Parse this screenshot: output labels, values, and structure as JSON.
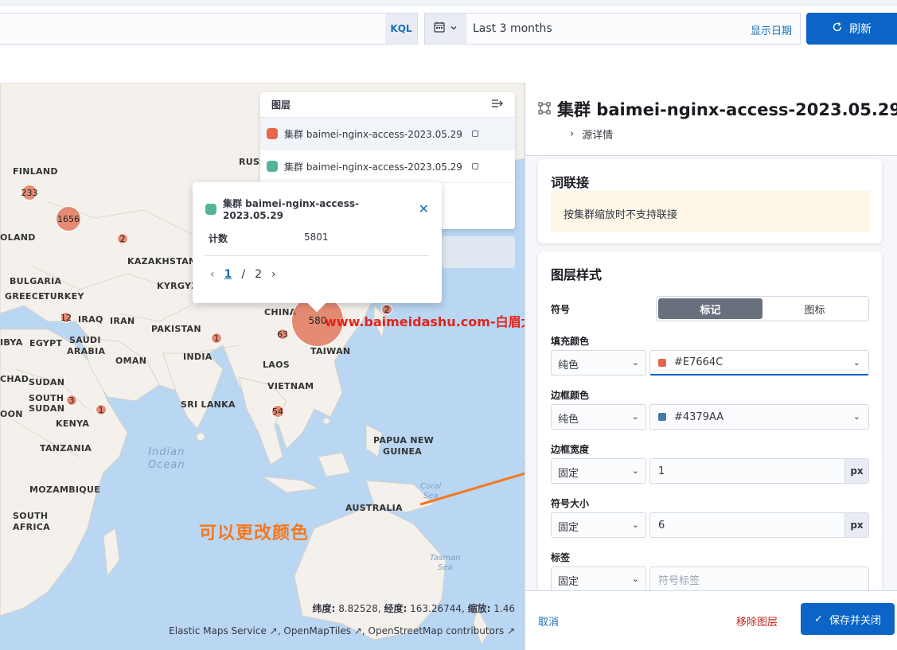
{
  "query_bar": {
    "kql_label": "KQL",
    "date_range": "Last 3 months",
    "show_dates": "显示日期",
    "refresh_label": "刷新"
  },
  "map": {
    "countries": [
      "FINLAND",
      "RUSS",
      "OLAND",
      "KAZAKHSTAN",
      "BULGARIA",
      "GREECE",
      "TURKEY",
      "KYRGYZS",
      "IRAQ",
      "IRAN",
      "CHINA",
      "PAKISTAN",
      "IBYA",
      "EGYPT",
      "SAUDI",
      "ARABIA",
      "INDIA",
      "TAIWAN",
      "OMAN",
      "LAOS",
      "CHAD",
      "SUDAN",
      "SOUTH",
      "SUDAN",
      "VIETNAM",
      "SRI LANKA",
      "OON",
      "KENYA",
      "PAPUA NEW",
      "GUINEA",
      "TANZANIA",
      "MOZAMBIQUE",
      "AUSTRALIA",
      "SOUTH",
      "AFRICA"
    ],
    "ocean_indian_1": "Indian",
    "ocean_indian_2": "Ocean",
    "coral_1": "Coral",
    "coral_2": "Sea",
    "tasman_1": "Tasman",
    "tasman_2": "Sea",
    "clusters": [
      "233",
      "1656",
      "2",
      "12",
      "63",
      "580",
      "2",
      "1",
      "3",
      "1",
      "54"
    ],
    "annotation": "可以更改颜色",
    "watermark": "www.baimeidashu.com-白眉大叔",
    "coords": {
      "lat_label": "纬度:",
      "lat": "8.82528,",
      "lon_label": "经度:",
      "lon": "163.26744,",
      "zoom_label": "缩放:",
      "zoom": "1.46"
    },
    "attribution": "Elastic Maps Service ↗, OpenMapTiles ↗, OpenStreetMap contributors ↗"
  },
  "layer_control": {
    "title": "图层",
    "layers": [
      {
        "name": "集群 baimei-nginx-access-2023.05.29",
        "color": "#E7664C"
      },
      {
        "name": "集群 baimei-nginx-access-2023.05.29",
        "color": "#54B399"
      }
    ]
  },
  "tooltip": {
    "title": "集群 baimei-nginx-access-2023.05.29",
    "color": "#54B399",
    "key": "计数",
    "value": "5801",
    "page_current": "1",
    "page_sep": "/",
    "page_total": "2"
  },
  "panel": {
    "title": "集群 baimei-nginx-access-2023.05.29",
    "source_details": "源详情",
    "join_card": {
      "title": "词联接",
      "message": "按集群缩放时不支持联接"
    },
    "style_card": {
      "title": "图层样式",
      "symbol_label": "符号",
      "symbol_options": [
        "标记",
        "图标"
      ],
      "fill_label": "填充颜色",
      "fill_mode": "纯色",
      "fill_color": "#E7664C",
      "border_label": "边框颜色",
      "border_mode": "纯色",
      "border_color": "#4379AA",
      "border_width_label": "边框宽度",
      "border_width_mode": "固定",
      "border_width_value": "1",
      "unit": "px",
      "symbol_size_label": "符号大小",
      "symbol_size_mode": "固定",
      "symbol_size_value": "6",
      "label_label": "标签",
      "label_mode": "固定",
      "label_placeholder": "符号标签"
    },
    "footer": {
      "cancel": "取消",
      "remove": "移除图层",
      "save": "保存并关闭"
    }
  }
}
